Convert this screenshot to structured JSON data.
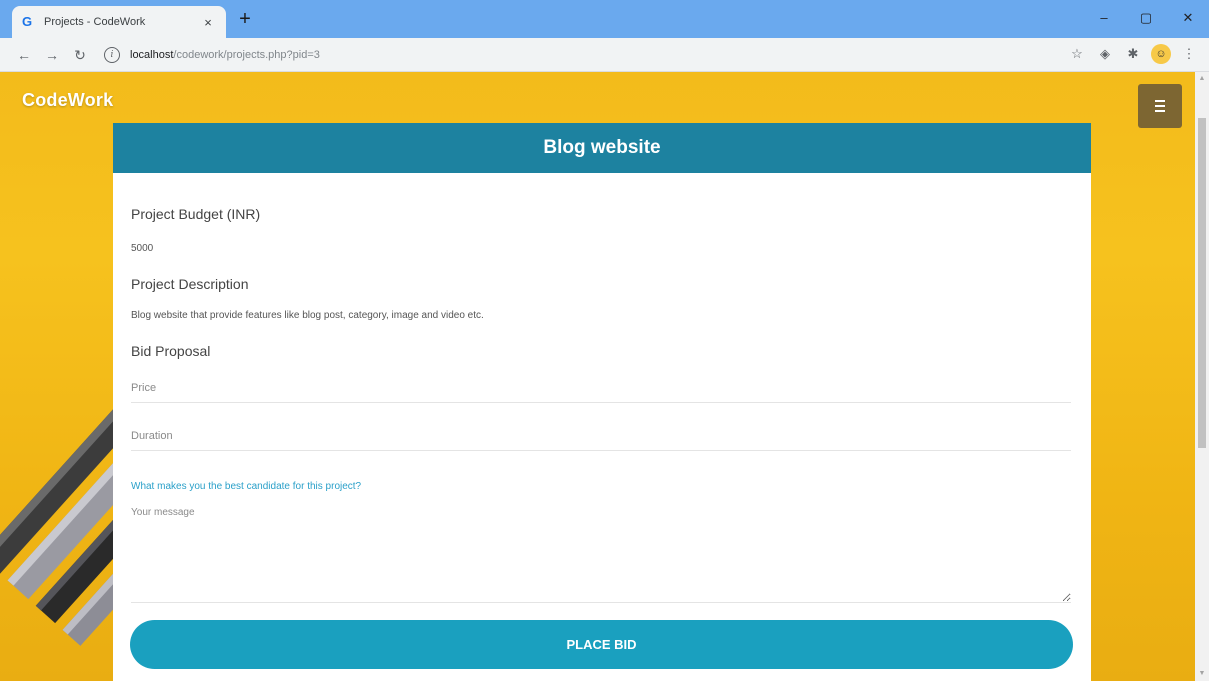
{
  "browser": {
    "tab_title": "Projects - CodeWork",
    "tab_close": "×",
    "new_tab": "+",
    "url_host": "localhost",
    "url_path": "/codework/projects.php?pid=3",
    "window_controls": [
      "–",
      "▢",
      "✕"
    ]
  },
  "site": {
    "brand": "CodeWork",
    "menu_icon": "hamburger-icon"
  },
  "project": {
    "title": "Blog website",
    "budget_label": "Project Budget (INR)",
    "budget_value": "5000",
    "description_label": "Project Description",
    "description_value": "Blog website that provide features like blog post, category, image and video etc.",
    "bid_label": "Bid Proposal"
  },
  "bid_form": {
    "price_placeholder": "Price",
    "duration_placeholder": "Duration",
    "question": "What makes you the best candidate for this project?",
    "message_placeholder": "Your message",
    "submit_label": "PLACE BID"
  },
  "colors": {
    "background": "#f3bb1b",
    "header": "#1d82a0",
    "button": "#1aa0bf",
    "link": "#2aa0c9"
  }
}
